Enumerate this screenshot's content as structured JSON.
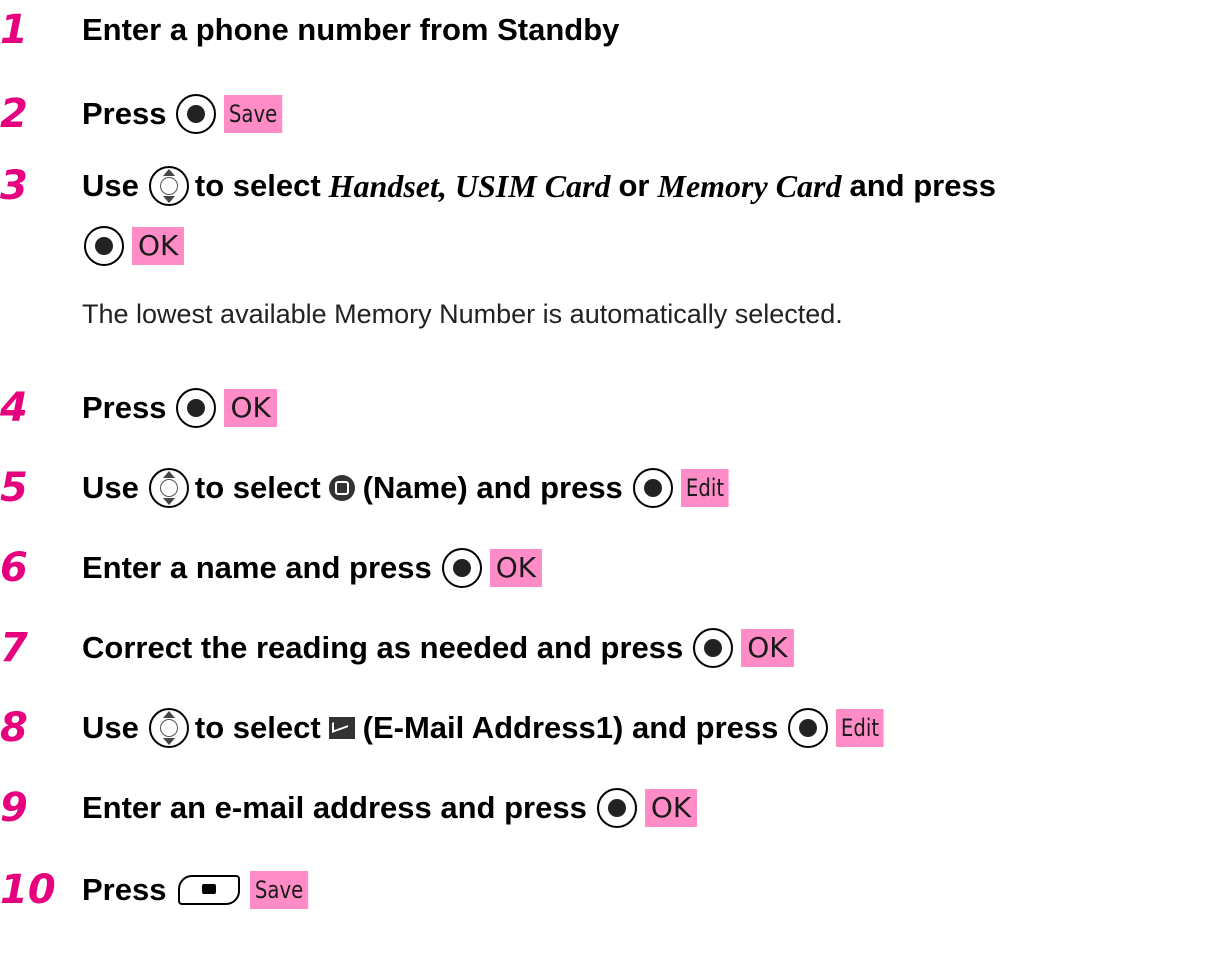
{
  "steps": [
    {
      "num": "1",
      "text": "Enter a phone number from Standby"
    },
    {
      "num": "2",
      "text": "Press",
      "key": "Save"
    },
    {
      "num": "3",
      "use": "Use",
      "mid": "to select",
      "opt1": "Handset, USIM Card",
      "or": "or",
      "opt2": "Memory Card",
      "and": "and press",
      "key": "OK",
      "note": "The lowest available Memory Number is automatically selected."
    },
    {
      "num": "4",
      "text": "Press",
      "key": "OK"
    },
    {
      "num": "5",
      "use": "Use",
      "mid": "to select",
      "label": "(Name) and press",
      "key": "Edit",
      "icon": "name-icon"
    },
    {
      "num": "6",
      "text": "Enter a name and press",
      "key": "OK"
    },
    {
      "num": "7",
      "text": "Correct the reading as needed and press",
      "key": "OK"
    },
    {
      "num": "8",
      "use": "Use",
      "mid": "to select",
      "label": "(E-Mail Address1) and press",
      "key": "Edit",
      "icon": "mail-icon"
    },
    {
      "num": "9",
      "text": "Enter an e-mail address and press",
      "key": "OK"
    },
    {
      "num": "10",
      "text": "Press",
      "key": "Save"
    }
  ]
}
